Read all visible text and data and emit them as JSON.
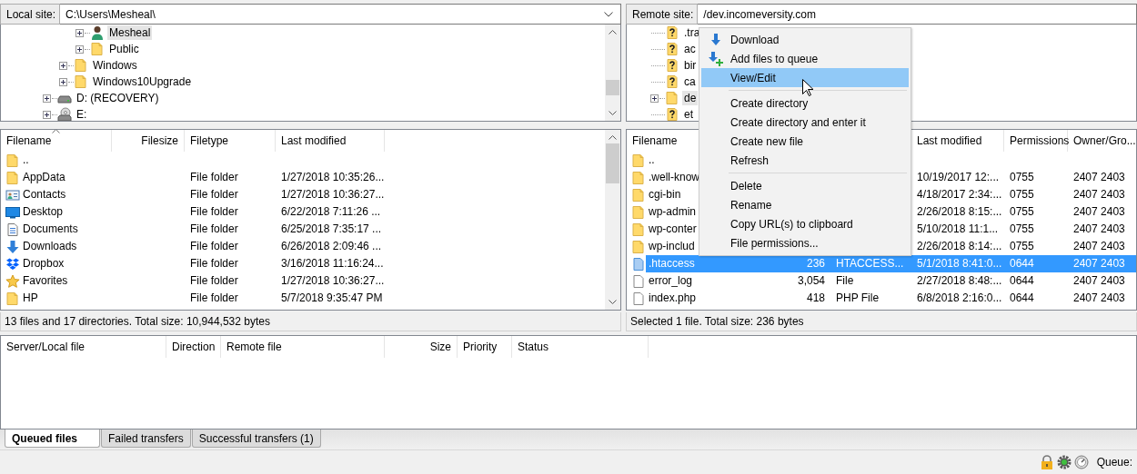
{
  "local": {
    "site_label": "Local site:",
    "path": "C:\\Users\\Mesheal\\",
    "tree": [
      {
        "children": [
          {
            "children": [
              {
                "label": "Mesheal",
                "kind": "user",
                "selected": true,
                "expanded": false
              },
              {
                "label": "Public",
                "kind": "folder",
                "selected": false,
                "expanded": false
              }
            ]
          },
          {
            "label": "Windows",
            "kind": "folder",
            "selected": false,
            "expanded": false
          },
          {
            "label": "Windows10Upgrade",
            "kind": "folder",
            "selected": false,
            "expanded": false
          }
        ]
      },
      {
        "label": "D: (RECOVERY)",
        "kind": "drive",
        "selected": false,
        "expanded": false
      },
      {
        "label": "E:",
        "kind": "disc-drive",
        "selected": false,
        "expanded": false
      }
    ],
    "columns": [
      {
        "label": "Filename",
        "kind": "name",
        "sorted": true
      },
      {
        "label": "Filesize",
        "kind": "size",
        "sorted": false
      },
      {
        "label": "Filetype",
        "kind": "type",
        "sorted": false
      },
      {
        "label": "Last modified",
        "kind": "modified",
        "sorted": false
      }
    ],
    "files": [
      {
        "name": "..",
        "kind": "folder",
        "selected": false
      },
      {
        "name": "AppData",
        "kind": "folder",
        "type": "File folder",
        "modified": "1/27/2018 10:35:26...",
        "selected": false
      },
      {
        "name": "Contacts",
        "kind": "contacts",
        "type": "File folder",
        "modified": "1/27/2018 10:36:27...",
        "selected": false
      },
      {
        "name": "Desktop",
        "kind": "desktop",
        "type": "File folder",
        "modified": "6/22/2018 7:11:26 ...",
        "selected": false
      },
      {
        "name": "Documents",
        "kind": "documents",
        "type": "File folder",
        "modified": "6/25/2018 7:35:17 ...",
        "selected": false
      },
      {
        "name": "Downloads",
        "kind": "downloads",
        "type": "File folder",
        "modified": "6/26/2018 2:09:46 ...",
        "selected": false
      },
      {
        "name": "Dropbox",
        "kind": "dropbox",
        "type": "File folder",
        "modified": "3/16/2018 11:16:24...",
        "selected": false
      },
      {
        "name": "Favorites",
        "kind": "favorites",
        "type": "File folder",
        "modified": "1/27/2018 10:36:27...",
        "selected": false
      },
      {
        "name": "HP",
        "kind": "folder",
        "type": "File folder",
        "modified": "5/7/2018 9:35:47 PM",
        "selected": false
      }
    ],
    "status": "13 files and 17 directories. Total size: 10,944,532 bytes"
  },
  "remote": {
    "site_label": "Remote site:",
    "path": "/dev.incomeversity.com",
    "tree": [
      {
        "label": ".tra",
        "kind": "unknown",
        "selected": false
      },
      {
        "label": "ac",
        "kind": "unknown",
        "selected": false
      },
      {
        "label": "bir",
        "kind": "unknown",
        "selected": false
      },
      {
        "label": "ca",
        "kind": "unknown",
        "selected": false
      },
      {
        "label": "de",
        "kind": "folder",
        "selected": true,
        "expanded": false
      },
      {
        "label": "et",
        "kind": "unknown",
        "selected": false
      }
    ],
    "columns": [
      {
        "label": "Filename",
        "kind": "name",
        "sorted": false
      },
      {
        "label": "Last modified",
        "kind": "modified",
        "sorted": false
      },
      {
        "label": "Permissions",
        "kind": "permissions",
        "sorted": false
      },
      {
        "label": "Owner/Gro...",
        "kind": "owner",
        "sorted": false
      }
    ],
    "files": [
      {
        "name": "..",
        "kind": "folder",
        "selected": false
      },
      {
        "name": ".well-know",
        "kind": "folder",
        "modified": "10/19/2017 12:...",
        "permissions": "0755",
        "owner": "2407 2403",
        "selected": false
      },
      {
        "name": "cgi-bin",
        "kind": "folder",
        "modified": "4/18/2017 2:34:...",
        "permissions": "0755",
        "owner": "2407 2403",
        "selected": false
      },
      {
        "name": "wp-admin",
        "kind": "folder",
        "modified": "2/26/2018 8:15:...",
        "permissions": "0755",
        "owner": "2407 2403",
        "selected": false
      },
      {
        "name": "wp-conter",
        "kind": "folder",
        "modified": "5/10/2018 11:1...",
        "permissions": "0755",
        "owner": "2407 2403",
        "selected": false
      },
      {
        "name": "wp-includ",
        "kind": "folder",
        "modified": "2/26/2018 8:14:...",
        "permissions": "0755",
        "owner": "2407 2403",
        "selected": false
      },
      {
        "name": ".htaccess",
        "kind": "file",
        "size": "236",
        "type": "HTACCESS...",
        "modified": "5/1/2018 8:41:0...",
        "permissions": "0644",
        "owner": "2407 2403",
        "selected": true
      },
      {
        "name": "error_log",
        "kind": "file",
        "size": "3,054",
        "type": "File",
        "modified": "2/27/2018 8:48:...",
        "permissions": "0644",
        "owner": "2407 2403",
        "selected": false
      },
      {
        "name": "index.php",
        "kind": "file",
        "size": "418",
        "type": "PHP File",
        "modified": "6/8/2018 2:16:0...",
        "permissions": "0644",
        "owner": "2407 2403",
        "selected": false
      }
    ],
    "status": "Selected 1 file. Total size: 236 bytes"
  },
  "context_menu": {
    "items": [
      {
        "kind": "download",
        "label": "Download",
        "selected": false
      },
      {
        "kind": "queue",
        "label": "Add files to queue",
        "selected": false
      },
      {
        "kind": "plain",
        "label": "View/Edit",
        "selected": true
      },
      {
        "kind": "separator"
      },
      {
        "kind": "plain",
        "label": "Create directory",
        "selected": false
      },
      {
        "kind": "plain",
        "label": "Create directory and enter it",
        "selected": false
      },
      {
        "kind": "plain",
        "label": "Create new file",
        "selected": false
      },
      {
        "kind": "plain",
        "label": "Refresh",
        "selected": false
      },
      {
        "kind": "separator"
      },
      {
        "kind": "plain",
        "label": "Delete",
        "selected": false
      },
      {
        "kind": "plain",
        "label": "Rename",
        "selected": false
      },
      {
        "kind": "plain",
        "label": "Copy URL(s) to clipboard",
        "selected": false
      },
      {
        "kind": "plain",
        "label": "File permissions...",
        "selected": false
      }
    ]
  },
  "queue": {
    "columns": [
      {
        "label": "Server/Local file",
        "kind": "local"
      },
      {
        "label": "Direction",
        "kind": "direction"
      },
      {
        "label": "Remote file",
        "kind": "remote"
      },
      {
        "label": "Size",
        "kind": "size"
      },
      {
        "label": "Priority",
        "kind": "priority"
      },
      {
        "label": "Status",
        "kind": "status"
      }
    ],
    "tabs": [
      {
        "label": "Queued files",
        "selected": true
      },
      {
        "label": "Failed transfers",
        "selected": false
      },
      {
        "label": "Successful transfers (1)",
        "selected": false
      }
    ]
  },
  "status_bar": {
    "queue_label": "Queue:"
  }
}
